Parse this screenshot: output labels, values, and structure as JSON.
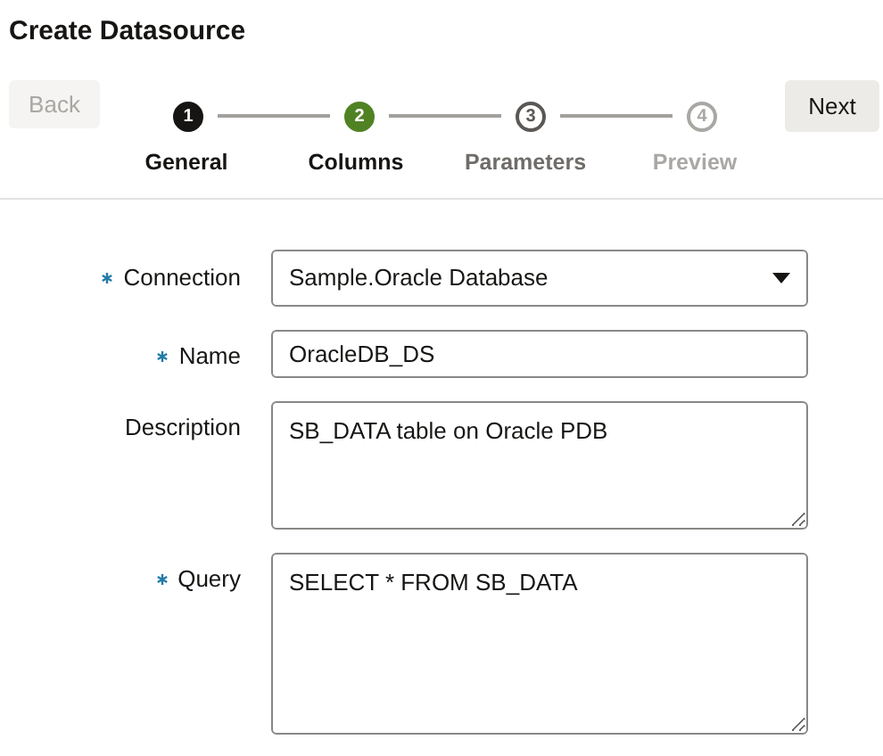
{
  "title": "Create Datasource",
  "back_button": {
    "label": "Back",
    "disabled": true
  },
  "next_button": {
    "label": "Next",
    "disabled": false
  },
  "steps": [
    {
      "number": "1",
      "label": "General",
      "visited": true,
      "selected": false,
      "disabled": false
    },
    {
      "number": "2",
      "label": "Columns",
      "visited": false,
      "selected": true,
      "disabled": false
    },
    {
      "number": "3",
      "label": "Parameters",
      "visited": false,
      "selected": false,
      "disabled": false
    },
    {
      "number": "4",
      "label": "Preview",
      "visited": false,
      "selected": false,
      "disabled": true
    }
  ],
  "fields": [
    {
      "kind": "select",
      "label": "Connection",
      "required": true,
      "value": "Sample.Oracle Database"
    },
    {
      "kind": "text",
      "label": "Name",
      "required": true,
      "value": "OracleDB_DS"
    },
    {
      "kind": "textarea",
      "label": "Description",
      "required": false,
      "value": "SB_DATA table on Oracle PDB"
    },
    {
      "kind": "textarea_tall",
      "label": "Query",
      "required": true,
      "value": "SELECT * FROM SB_DATA"
    }
  ]
}
